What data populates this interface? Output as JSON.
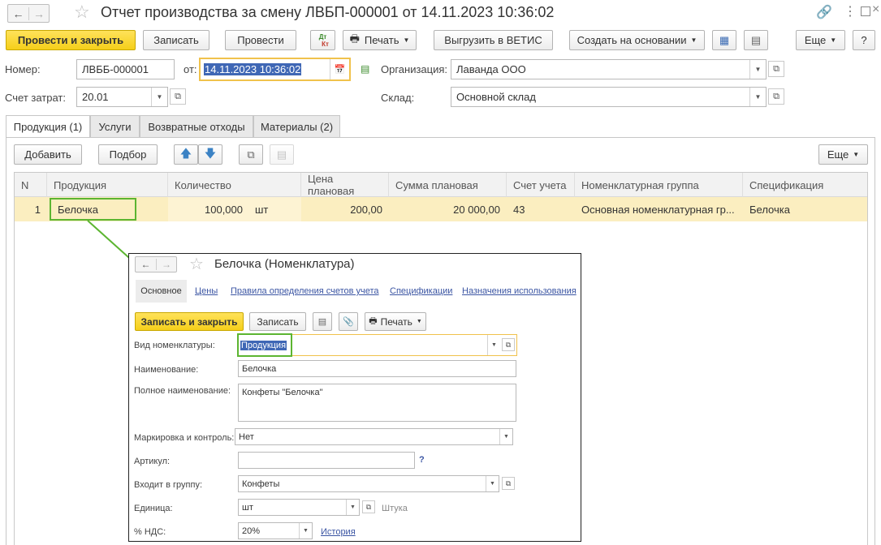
{
  "window": {
    "title": "Отчет производства за смену ЛВБП-000001 от 14.11.2023 10:36:02"
  },
  "toolbar": {
    "post_close": "Провести и закрыть",
    "save": "Записать",
    "post": "Провести",
    "dt_kt_top": "Дт",
    "dt_kt_bottom": "Кт",
    "print": "Печать",
    "vetis": "Выгрузить в ВЕТИС",
    "create_based": "Создать на основании",
    "more": "Еще",
    "help": "?"
  },
  "header": {
    "number_label": "Номер:",
    "number_value": "ЛВББ-000001",
    "date_label": "от:",
    "date_value": "14.11.2023 10:36:02",
    "org_label": "Организация:",
    "org_value": "Лаванда ООО",
    "account_label": "Счет затрат:",
    "account_value": "20.01",
    "warehouse_label": "Склад:",
    "warehouse_value": "Основной склад"
  },
  "tabs": [
    "Продукция (1)",
    "Услуги",
    "Возвратные отходы",
    "Материалы (2)"
  ],
  "table_toolbar": {
    "add": "Добавить",
    "pick": "Подбор",
    "more": "Еще"
  },
  "table": {
    "columns": [
      "N",
      "Продукция",
      "Количество",
      "Цена плановая",
      "Сумма плановая",
      "Счет учета",
      "Номенклатурная группа",
      "Спецификация"
    ],
    "rows": [
      {
        "n": "1",
        "product": "Белочка",
        "qty": "100,000",
        "unit": "шт",
        "price": "200,00",
        "sum": "20 000,00",
        "account": "43",
        "group": "Основная номенклатурная гр...",
        "spec": "Белочка"
      }
    ]
  },
  "inset": {
    "title": "Белочка (Номенклатура)",
    "nav": [
      "Основное",
      "Цены",
      "Правила определения счетов учета",
      "Спецификации",
      "Назначения использования"
    ],
    "save_close": "Записать и закрыть",
    "save": "Записать",
    "print": "Печать",
    "kind_label": "Вид номенклатуры:",
    "kind_value": "Продукция",
    "name_label": "Наименование:",
    "name_value": "Белочка",
    "full_name_label": "Полное наименование:",
    "full_name_value": "Конфеты \"Белочка\"",
    "marking_label": "Маркировка и контроль:",
    "marking_value": "Нет",
    "article_label": "Артикул:",
    "article_value": "",
    "article_help": "?",
    "group_label": "Входит в группу:",
    "group_value": "Конфеты",
    "unit_label": "Единица:",
    "unit_value": "шт",
    "unit_hint": "Штука",
    "vat_label": "% НДС:",
    "vat_value": "20%",
    "vat_history": "История"
  },
  "colors": {
    "primary_button": "#f5cf1a",
    "selected_row": "#fbeec0",
    "highlight_green": "#5cb531",
    "focus_border": "#f0c24c",
    "link": "#3b55a3"
  }
}
